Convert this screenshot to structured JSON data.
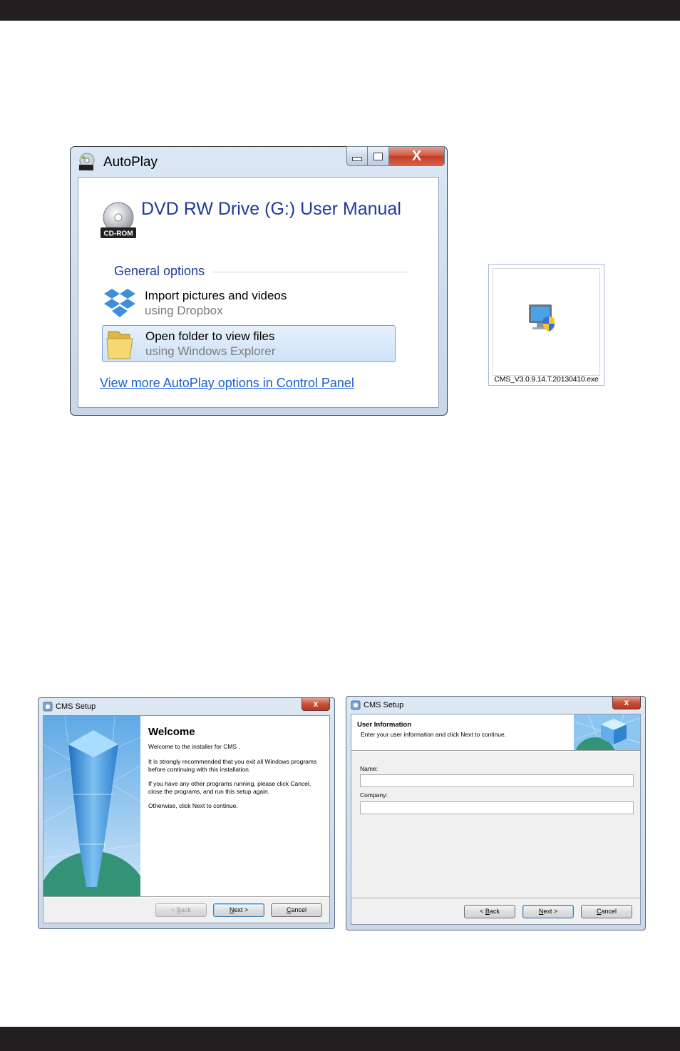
{
  "autoplay": {
    "title": "AutoPlay",
    "drive_title": "DVD RW Drive (G:) User Manual",
    "cdrom_label": "CD-ROM",
    "group_label": "General options",
    "options": [
      {
        "label": "Import pictures and videos",
        "sub": "using Dropbox",
        "icon": "dropbox-icon"
      },
      {
        "label": "Open folder to view files",
        "sub": "using Windows Explorer",
        "icon": "folder-icon",
        "selected": true
      }
    ],
    "more_link": "View more AutoPlay options in Control Panel",
    "close_glyph": "X"
  },
  "file_icon": {
    "filename": "CMS_V3.0.9.14.T.20130410.exe",
    "icon": "installer-monitor-icon"
  },
  "setup_welcome": {
    "title": "CMS Setup",
    "close_glyph": "x",
    "heading": "Welcome",
    "line1": "Welcome to the installer for CMS .",
    "para2": "It is strongly recommended that you exit all Windows programs before continuing with this installation.",
    "para3": "If you have any other programs running, please click Cancel, close the programs, and run this setup again.",
    "para4": "Otherwise, click Next to continue.",
    "buttons": {
      "back_pre": "< ",
      "back_key": "B",
      "back_rest": "ack",
      "next_key": "N",
      "next_rest": "ext >",
      "cancel_key": "C",
      "cancel_rest": "ancel"
    },
    "back_enabled": false
  },
  "setup_user": {
    "title": "CMS Setup",
    "close_glyph": "x",
    "heading": "User Information",
    "subheading": "Enter your user information and click Next to continue.",
    "name_label": "Name:",
    "name_value": "",
    "company_label": "Company:",
    "company_value": "",
    "buttons": {
      "back_pre": "< ",
      "back_key": "B",
      "back_rest": "ack",
      "next_key": "N",
      "next_rest": "ext >",
      "cancel_key": "C",
      "cancel_rest": "ancel"
    },
    "back_enabled": true
  },
  "colors": {
    "band": "#231f20",
    "heading_blue": "#1e3b9a",
    "link_blue": "#1a5fd6",
    "close_red": "#c13d24"
  }
}
